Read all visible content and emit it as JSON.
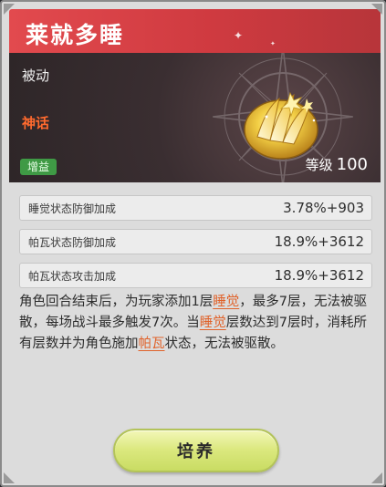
{
  "skill": {
    "title": "莱就多睡",
    "type": "被动",
    "rarity": "神话",
    "tag": "增益",
    "level_label": "等级",
    "level_value": "100"
  },
  "stats": [
    {
      "name": "睡觉状态防御加成",
      "value": "3.78%+903"
    },
    {
      "name": "帕瓦状态防御加成",
      "value": "18.9%+3612"
    },
    {
      "name": "帕瓦状态攻击加成",
      "value": "18.9%+3612"
    }
  ],
  "description": {
    "p1": "角色回合结束后，为玩家添加1层",
    "kw1": "睡觉",
    "p2": "，最多7层，无法被驱散，每场战斗最多触发7次。当",
    "kw2": "睡觉",
    "p3": "层数达到7层时，消耗所有层数并为角色施加",
    "kw3": "帕瓦",
    "p4": "状态，无法被驱散。"
  },
  "button": {
    "label": "培养"
  },
  "colors": {
    "header": "#e24a4e",
    "rarity": "#ff6a2e",
    "tag": "#3f9a45",
    "keyword": "#e0622a",
    "button": "#dbe87e"
  },
  "icons": [
    "golden-shell-burst-icon",
    "compass-star-icon",
    "sparkle-icon",
    "corner-ornament-icon"
  ]
}
